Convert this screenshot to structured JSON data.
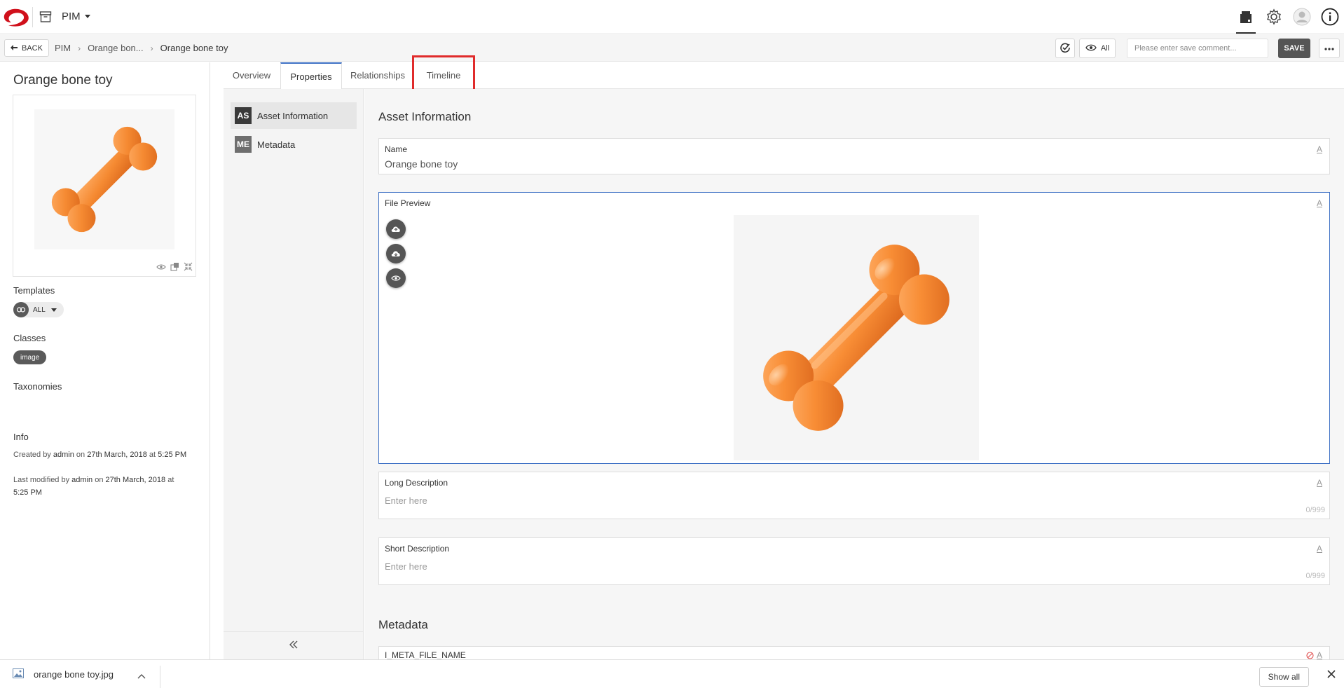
{
  "app": {
    "name": "PIM"
  },
  "header": {
    "icons": [
      "store-icon",
      "gear-icon",
      "user-icon",
      "info-icon"
    ]
  },
  "breadcrumb": {
    "back_label": "BACK",
    "items": [
      "PIM",
      "Orange bon...",
      "Orange bone toy"
    ]
  },
  "toolbar": {
    "visibility_label": "All",
    "comment_placeholder": "Please enter save comment...",
    "save_label": "SAVE"
  },
  "left_panel": {
    "title": "Orange bone toy",
    "templates_label": "Templates",
    "template_value": "ALL",
    "classes_label": "Classes",
    "class_badge": "image",
    "taxonomies_label": "Taxonomies",
    "info_label": "Info",
    "created": {
      "prefix": "Created by",
      "user": "admin",
      "on": "on",
      "date": "27th March, 2018",
      "at": "at",
      "time": "5:25 PM"
    },
    "modified": {
      "prefix": "Last modified by",
      "user": "admin",
      "on": "on",
      "date": "27th March,",
      "date2": "2018",
      "at": "at",
      "time": "5:25 PM"
    }
  },
  "tabs": [
    "Overview",
    "Properties",
    "Relationships",
    "Timeline"
  ],
  "active_tab": "Properties",
  "nav": [
    {
      "abbr": "AS",
      "label": "Asset Information"
    },
    {
      "abbr": "ME",
      "label": "Metadata"
    }
  ],
  "content": {
    "section1_title": "Asset Information",
    "name_field": {
      "label": "Name",
      "value": "Orange bone toy",
      "type_mark": "A"
    },
    "file_preview": {
      "label": "File Preview",
      "type_mark": "A"
    },
    "long_desc": {
      "label": "Long Description",
      "placeholder": "Enter here",
      "counter": "0/999",
      "type_mark": "A"
    },
    "short_desc": {
      "label": "Short Description",
      "placeholder": "Enter here",
      "counter": "0/999",
      "type_mark": "A"
    },
    "section2_title": "Metadata",
    "meta_field": {
      "label": "I_META_FILE_NAME",
      "type_mark": "A"
    }
  },
  "downloads": {
    "file_name": "orange bone toy.jpg",
    "show_all": "Show all"
  },
  "colors": {
    "accent": "#3c6fc4",
    "highlight": "#e02b2b",
    "bone": "#f0852d",
    "logo": "#d0101b"
  }
}
